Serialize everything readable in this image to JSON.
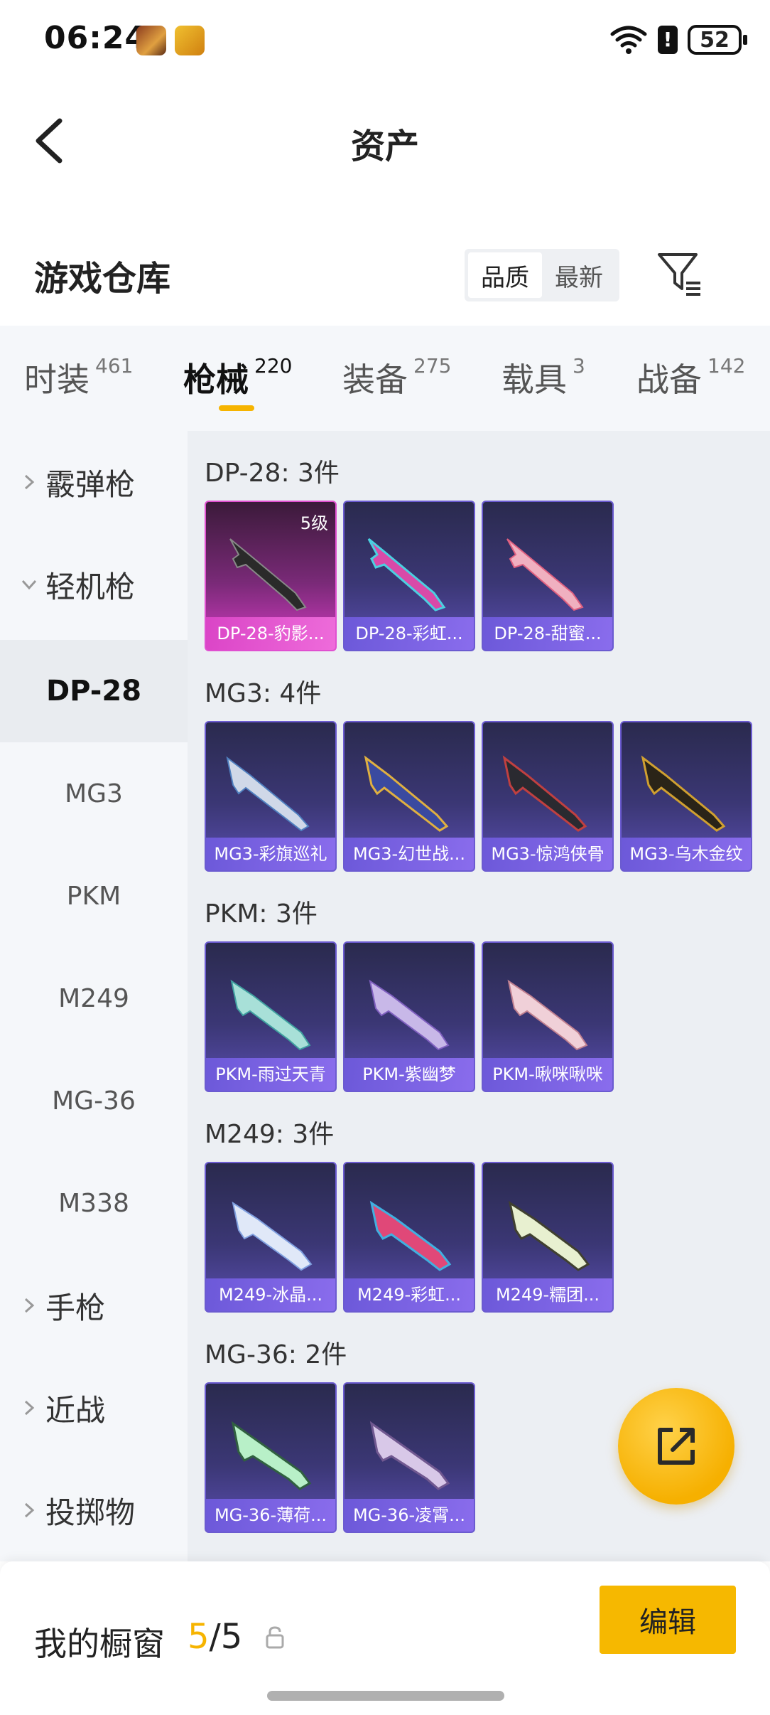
{
  "status_bar": {
    "time": "06:24",
    "alert": "!",
    "battery": "52"
  },
  "header": {
    "title": "资产"
  },
  "warehouse": {
    "title": "游戏仓库",
    "sort_options": [
      "品质",
      "最新"
    ],
    "sort_selected": "品质"
  },
  "tabs": [
    {
      "label": "时装",
      "count": "461"
    },
    {
      "label": "枪械",
      "count": "220"
    },
    {
      "label": "装备",
      "count": "275"
    },
    {
      "label": "载具",
      "count": "3"
    },
    {
      "label": "战备",
      "count": "142"
    }
  ],
  "active_tab": "枪械",
  "sidebar": {
    "items": [
      {
        "label": "霰弹枪",
        "type": "group",
        "expanded": false
      },
      {
        "label": "轻机枪",
        "type": "group",
        "expanded": true
      },
      {
        "label": "DP-28",
        "type": "child",
        "selected": true
      },
      {
        "label": "MG3",
        "type": "child"
      },
      {
        "label": "PKM",
        "type": "child"
      },
      {
        "label": "M249",
        "type": "child"
      },
      {
        "label": "MG-36",
        "type": "child"
      },
      {
        "label": "M338",
        "type": "child"
      },
      {
        "label": "手枪",
        "type": "group",
        "expanded": false
      },
      {
        "label": "近战",
        "type": "group",
        "expanded": false
      },
      {
        "label": "投掷物",
        "type": "group",
        "expanded": false
      }
    ]
  },
  "sections": [
    {
      "title": "DP-28: 3件",
      "cards": [
        {
          "label": "DP-28-豹影...",
          "level": "5级",
          "premium": true
        },
        {
          "label": "DP-28-彩虹..."
        },
        {
          "label": "DP-28-甜蜜..."
        }
      ]
    },
    {
      "title": "MG3: 4件",
      "cards": [
        {
          "label": "MG3-彩旗巡礼"
        },
        {
          "label": "MG3-幻世战..."
        },
        {
          "label": "MG3-惊鸿侠骨"
        },
        {
          "label": "MG3-乌木金纹"
        }
      ]
    },
    {
      "title": "PKM: 3件",
      "cards": [
        {
          "label": "PKM-雨过天青"
        },
        {
          "label": "PKM-紫幽梦"
        },
        {
          "label": "PKM-啾咪啾咪"
        }
      ]
    },
    {
      "title": "M249: 3件",
      "cards": [
        {
          "label": "M249-冰晶..."
        },
        {
          "label": "M249-彩虹..."
        },
        {
          "label": "M249-糯团..."
        }
      ]
    },
    {
      "title": "MG-36: 2件",
      "cards": [
        {
          "label": "MG-36-薄荷..."
        },
        {
          "label": "MG-36-凌霄..."
        }
      ]
    }
  ],
  "bottom": {
    "showcase_label": "我的橱窗",
    "showcase_current": "5",
    "showcase_sep": "/",
    "showcase_max": "5",
    "edit_label": "编辑"
  },
  "colors": {
    "accent": "#f6b400",
    "card_base": "#3b3775",
    "card_premium": "#d43bc2"
  }
}
